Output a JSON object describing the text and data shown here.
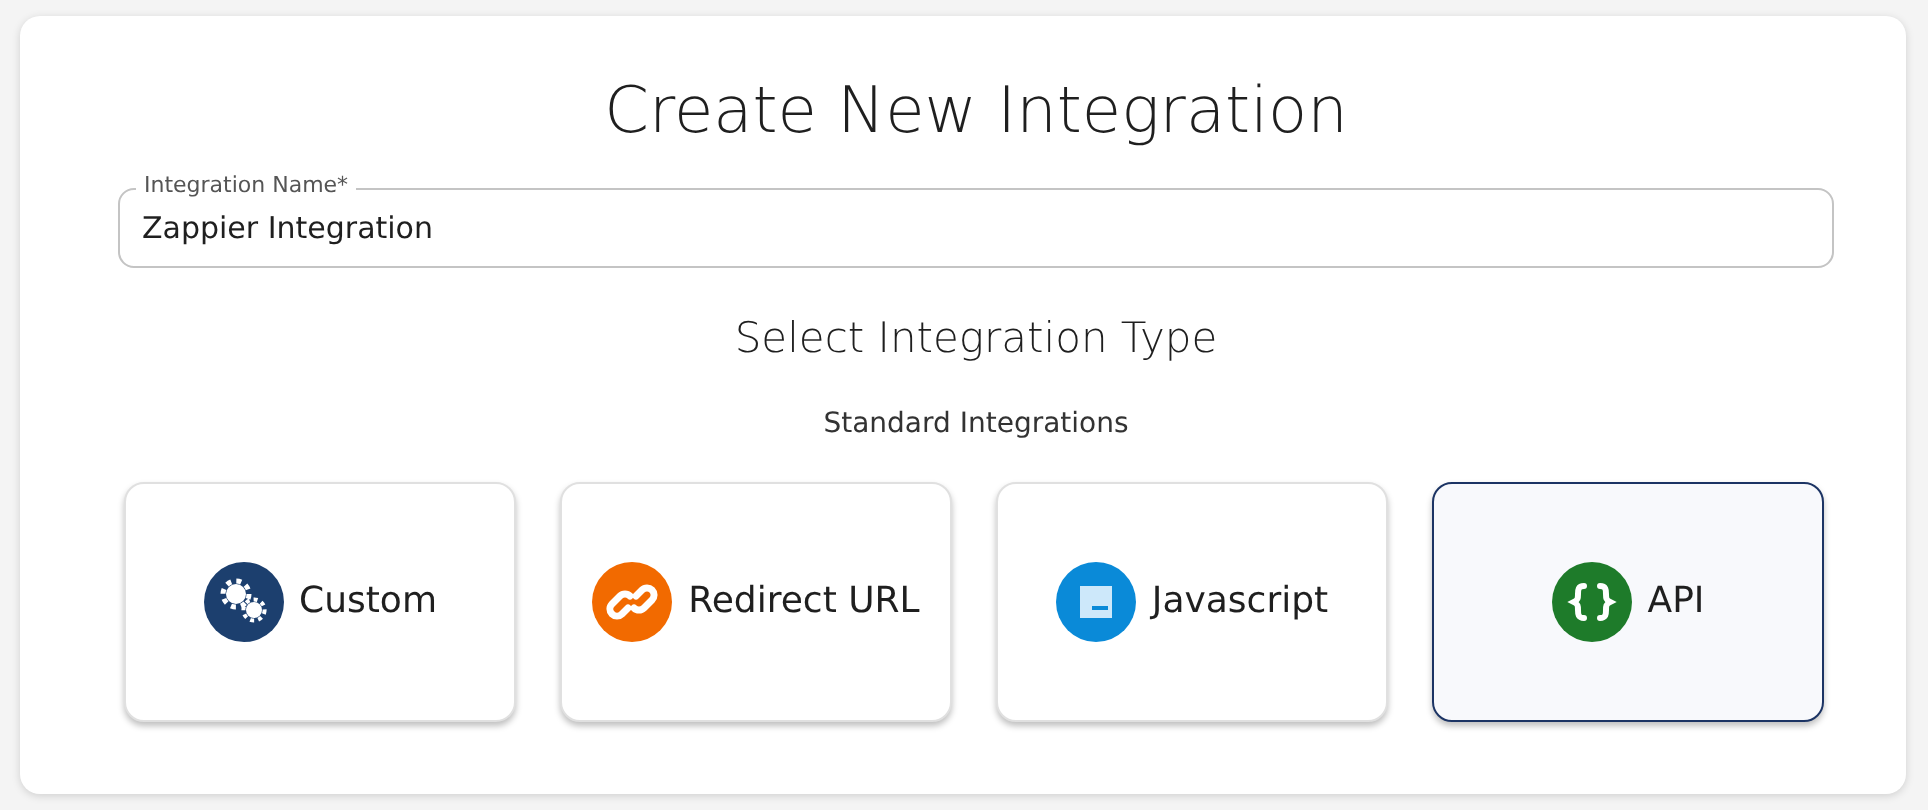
{
  "title": "Create New Integration",
  "name_field": {
    "label": "Integration Name",
    "required_mark": "*",
    "value": "Zappier Integration"
  },
  "section_title": "Select Integration Type",
  "group_title": "Standard Integrations",
  "types": [
    {
      "label": "Custom",
      "kind": "gears",
      "color": "#1c3f6e",
      "selected": false
    },
    {
      "label": "Redirect URL",
      "kind": "link",
      "color": "#f26a00",
      "selected": false
    },
    {
      "label": "Javascript",
      "kind": "script",
      "color": "#0a8ad8",
      "selected": false
    },
    {
      "label": "API",
      "kind": "braces",
      "color": "#1e7b2a",
      "selected": true
    }
  ]
}
